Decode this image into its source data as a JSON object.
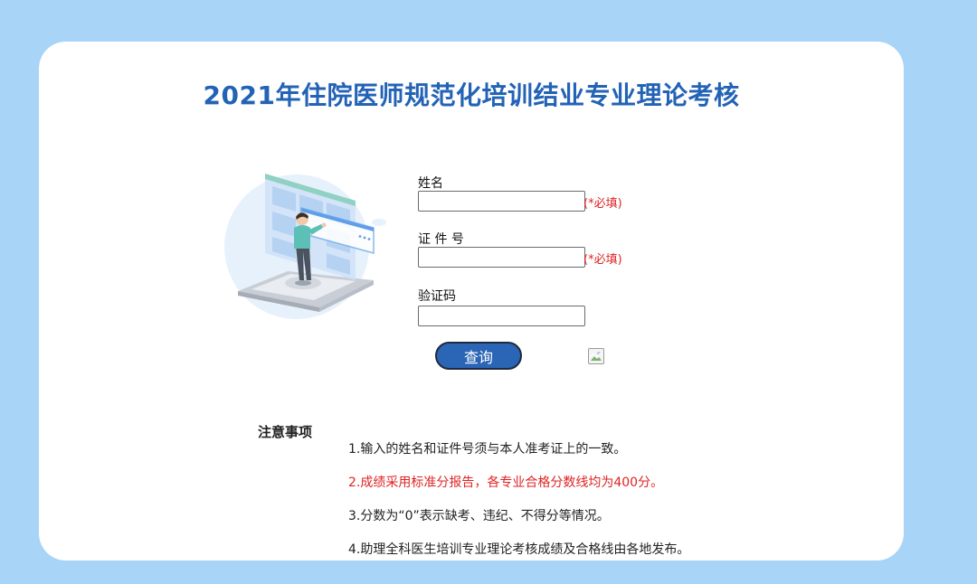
{
  "page": {
    "title": "2021年住院医师规范化培训结业专业理论考核"
  },
  "form": {
    "name": {
      "label": "姓名",
      "value": "",
      "required_note": "(*必填)"
    },
    "id_number": {
      "label": "证 件 号",
      "value": "",
      "required_note": "(*必填)"
    },
    "captcha": {
      "label": "验证码",
      "value": "",
      "image": "broken-image-icon"
    },
    "submit_label": "查询"
  },
  "notes": {
    "title": "注意事项",
    "items": [
      "1.输入的姓名和证件号须与本人准考证上的一致。",
      "2.成绩采用标准分报告，各专业合格分数线均为400分。",
      "3.分数为“0”表示缺考、违纪、不得分等情况。",
      "4.助理全科医生培训专业理论考核成绩及合格线由各地发布。"
    ],
    "highlight_color": "#e02323"
  },
  "colors": {
    "background": "#a8d4f7",
    "title": "#2363b6",
    "button": "#2a66b5"
  }
}
